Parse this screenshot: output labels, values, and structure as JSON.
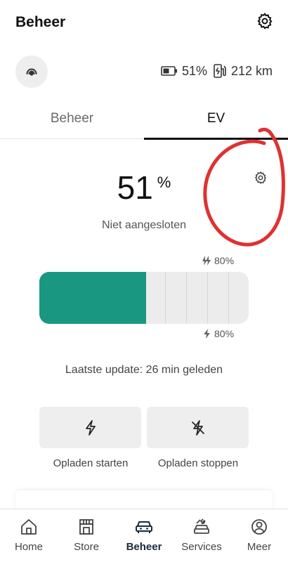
{
  "header": {
    "title": "Beheer",
    "settings_icon": "gear-icon"
  },
  "status": {
    "signal_icon": "remote-signal-icon",
    "battery_icon": "battery-icon",
    "battery_text": "51%",
    "range_icon": "fuel-range-icon",
    "range_text": "212 km"
  },
  "tabs": [
    {
      "label": "Beheer",
      "active": false
    },
    {
      "label": "EV",
      "active": true
    }
  ],
  "charge": {
    "percent": "51",
    "percent_unit": "%",
    "plug_state": "Niet aangesloten",
    "settings_icon": "gear-icon",
    "limit_top": "80%",
    "limit_bottom": "80%",
    "level_fraction": 0.51,
    "last_update": "Laatste update: 26 min geleden",
    "fill_color": "#1a9781"
  },
  "actions": {
    "start_label": "Opladen starten",
    "stop_label": "Opladen stoppen"
  },
  "nav": [
    {
      "label": "Home",
      "icon": "home-icon",
      "active": false
    },
    {
      "label": "Store",
      "icon": "store-icon",
      "active": false
    },
    {
      "label": "Beheer",
      "icon": "car-icon",
      "active": true
    },
    {
      "label": "Services",
      "icon": "services-icon",
      "active": false
    },
    {
      "label": "Meer",
      "icon": "profile-icon",
      "active": false
    }
  ],
  "colors": {
    "accent": "#1a9781",
    "annotation": "#e03131",
    "active_nav": "#1a2a3d"
  }
}
